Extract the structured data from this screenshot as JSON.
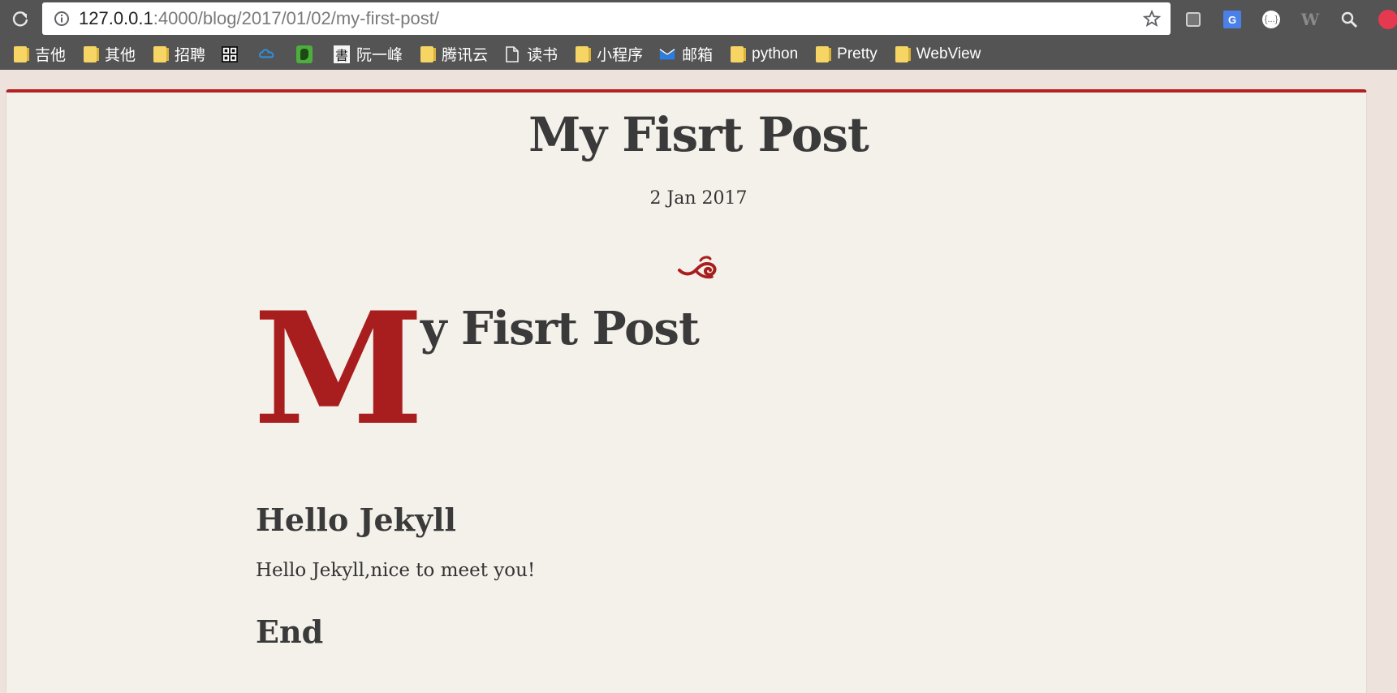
{
  "browser": {
    "url_host": "127.0.0.1",
    "url_path": ":4000/blog/2017/01/02/my-first-post/",
    "bookmarks": [
      {
        "label": "吉他",
        "icon": "folder-icon"
      },
      {
        "label": "其他",
        "icon": "folder-icon"
      },
      {
        "label": "招聘",
        "icon": "folder-icon"
      },
      {
        "label": "",
        "icon": "code-icon"
      },
      {
        "label": "",
        "icon": "cloud-icon"
      },
      {
        "label": "",
        "icon": "evernote-icon"
      },
      {
        "label": "阮一峰",
        "icon": "calligraphy-icon"
      },
      {
        "label": "腾讯云",
        "icon": "folder-icon"
      },
      {
        "label": "读书",
        "icon": "page-icon"
      },
      {
        "label": "小程序",
        "icon": "folder-icon"
      },
      {
        "label": "邮箱",
        "icon": "mail-icon"
      },
      {
        "label": "python",
        "icon": "folder-icon"
      },
      {
        "label": "Pretty",
        "icon": "folder-icon"
      },
      {
        "label": "WebView",
        "icon": "folder-icon"
      }
    ],
    "extensions": [
      "extension-icon",
      "translate-icon",
      "json-icon",
      "w-icon",
      "zoom-icon",
      "profile-icon"
    ]
  },
  "post": {
    "title": "My Fisrt Post",
    "date": "2 Jan 2017",
    "dropcap": "M",
    "heading_rest": "y Fisrt Post",
    "h2_first": "Hello Jekyll",
    "paragraph": "Hello Jekyll,nice to meet you!",
    "h2_second": "End"
  },
  "colors": {
    "accent": "#b22222",
    "chrome": "#545454",
    "page_bg": "#f4f0ea",
    "text": "#3a3a3a"
  }
}
